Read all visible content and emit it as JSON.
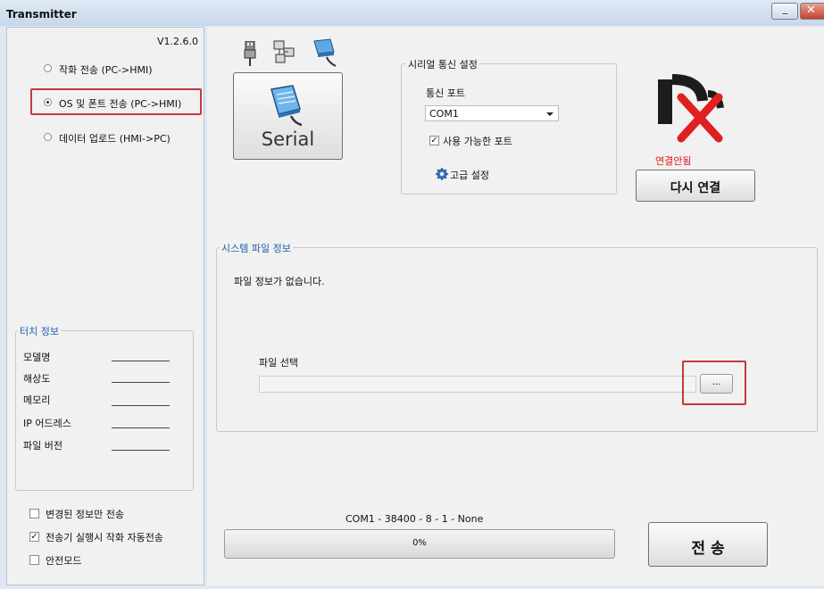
{
  "window": {
    "title": "Transmitter",
    "minimize_glyph": "▭",
    "close_glyph": "✕"
  },
  "sidebar": {
    "version": "V1.2.6.0",
    "modes": [
      {
        "label": "작화 전송 (PC->HMI)",
        "selected": false
      },
      {
        "label": "OS 및 폰트 전송 (PC->HMI)",
        "selected": true
      },
      {
        "label": "데이터 업로드 (HMI->PC)",
        "selected": false
      }
    ],
    "touch_info": {
      "title": "터치 정보",
      "fields": [
        "모델명",
        "해상도",
        "메모리",
        "IP 어드레스",
        "파일 버전"
      ]
    },
    "options": [
      {
        "label": "변경된 정보만 전송",
        "checked": false
      },
      {
        "label": "전송기 실행시 작화 자동전송",
        "checked": true
      },
      {
        "label": "안전모드",
        "checked": false
      }
    ]
  },
  "connection": {
    "type_label": "Serial",
    "type_icons": [
      "usb-icon",
      "ethernet-icon",
      "serial-icon"
    ]
  },
  "serial_settings": {
    "title": "시리얼 통신 설정",
    "port_label": "통신 포트",
    "port_value": "COM1",
    "available_ports_label": "사용 가능한 포트",
    "available_ports_checked": true,
    "advanced_label": "고급 설정"
  },
  "status": {
    "connection_text": "연결안됨",
    "reconnect_label": "다시 연결",
    "status_color": "#e01414"
  },
  "system_file": {
    "title": "시스템 파일 정보",
    "info_text": "파일 정보가 없습니다.",
    "file_select_label": "파일 선택",
    "file_path": "",
    "browse_label": "..."
  },
  "footer": {
    "port_status": "COM1 - 38400 - 8 - 1 - None",
    "progress_text": "0%",
    "progress_value": 0,
    "send_label": "전 송"
  },
  "colors": {
    "accent": "#1f5fb0",
    "highlight": "#c23a3a"
  }
}
